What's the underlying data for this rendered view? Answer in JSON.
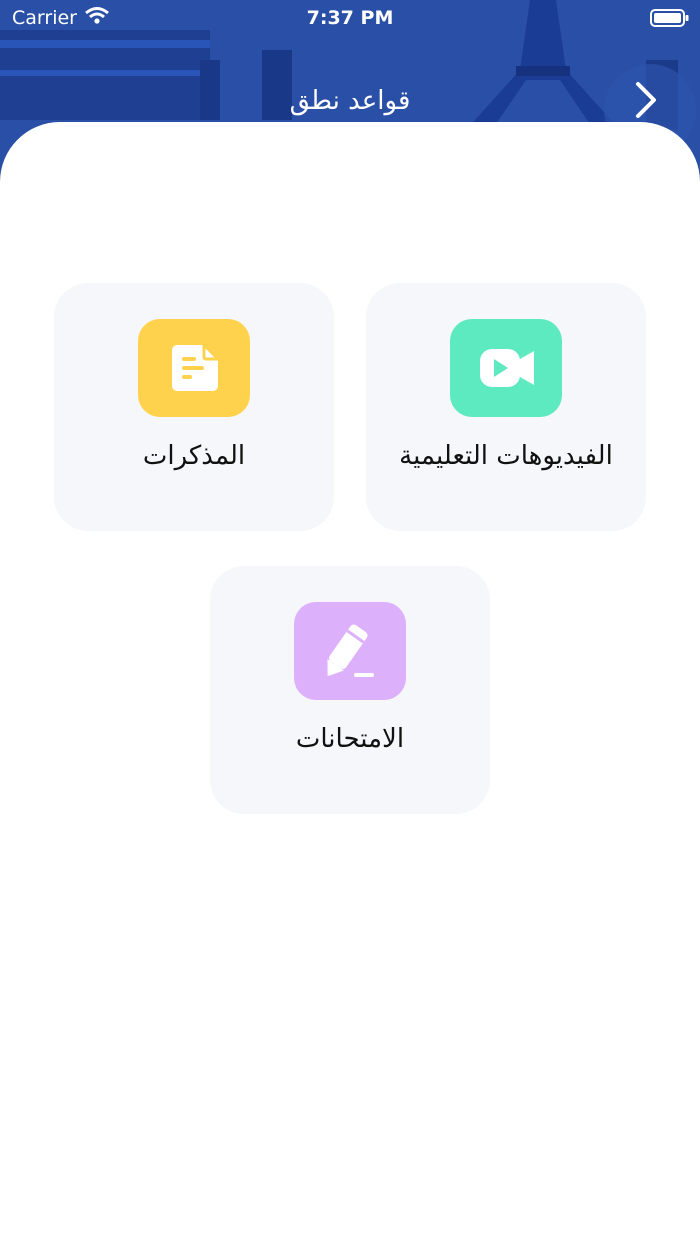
{
  "status_bar": {
    "carrier": "Carrier",
    "time": "7:37 PM"
  },
  "header": {
    "title": "قواعد نطق"
  },
  "cards": [
    {
      "label": "الفيديوهات التعليمية",
      "icon": "video-icon",
      "color": "#5eeac0"
    },
    {
      "label": "المذكرات",
      "icon": "note-icon",
      "color": "#ffd24d"
    },
    {
      "label": "الامتحانات",
      "icon": "pencil-icon",
      "color": "#ddb0fb"
    }
  ],
  "colors": {
    "header_bg": "#2a4fa6",
    "card_bg": "#f6f7fb"
  }
}
